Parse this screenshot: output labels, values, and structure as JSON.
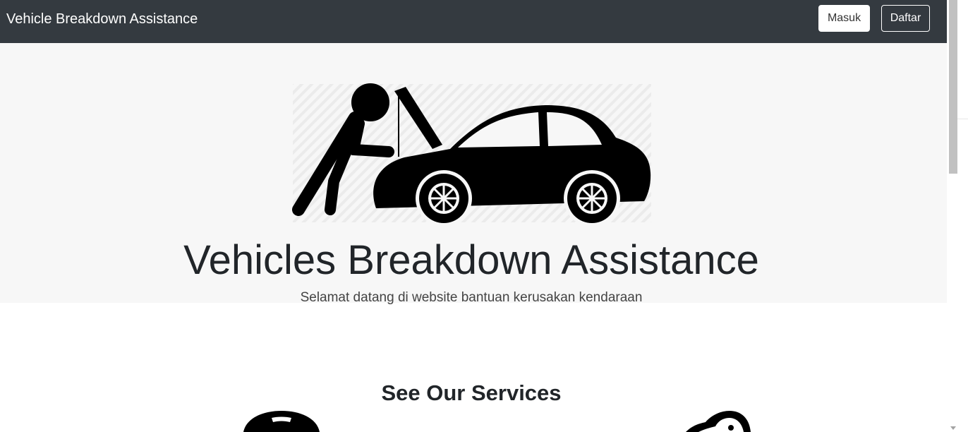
{
  "navbar": {
    "brand": "Vehicle Breakdown Assistance",
    "login_label": "Masuk",
    "register_label": "Daftar"
  },
  "hero": {
    "image_icon": "mechanic-repairing-car-icon",
    "title": "Vehicles Breakdown Assistance",
    "subtitle": "Selamat datang di website bantuan kerusakan kendaraan"
  },
  "services": {
    "title": "See Our Services",
    "icons": [
      "phone-service-icon",
      "wrench-service-icon"
    ]
  },
  "colors": {
    "navbar_bg": "#343a40",
    "hero_bg": "#f7f7f7",
    "text": "#212529"
  }
}
